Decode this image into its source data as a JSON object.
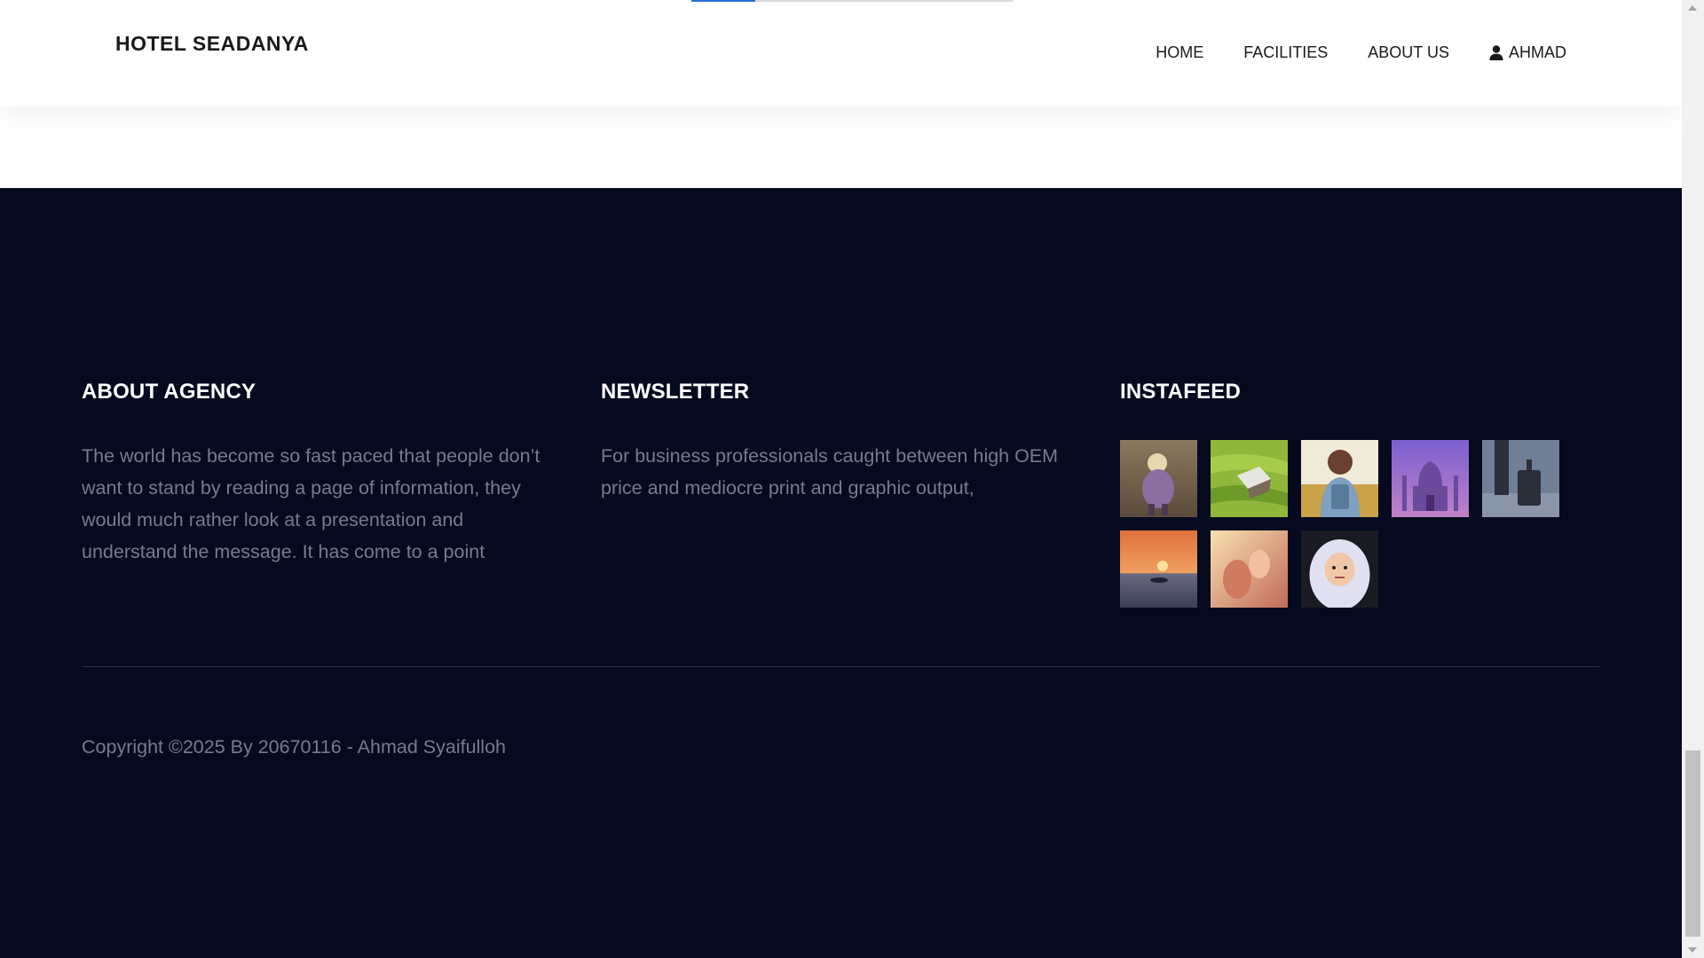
{
  "header": {
    "brand": "HOTEL SEADANYA",
    "progress_fraction": 0.2,
    "nav": [
      {
        "label": "HOME"
      },
      {
        "label": "FACILITIES"
      },
      {
        "label": "ABOUT US"
      },
      {
        "label": "AHMAD",
        "icon": "user-icon"
      }
    ]
  },
  "footer": {
    "about": {
      "title": "ABOUT AGENCY",
      "text": "The world has become so fast paced that people don’t want to stand by reading a page of information, they would much rather look at a presentation and understand the message. It has come to a point"
    },
    "newsletter": {
      "title": "NEWSLETTER",
      "text": "For business professionals caught between high OEM price and mediocre print and graphic output,"
    },
    "instafeed": {
      "title": "INSTAFEED",
      "images": [
        {
          "name": "child-walking-photo"
        },
        {
          "name": "rice-terrace-hut-photo"
        },
        {
          "name": "woman-backpack-photo"
        },
        {
          "name": "taj-mahal-photo"
        },
        {
          "name": "traveler-suitcase-photo"
        },
        {
          "name": "sunset-sea-photo"
        },
        {
          "name": "hands-sunlight-photo"
        },
        {
          "name": "child-hood-photo"
        }
      ]
    },
    "copyright": "Copyright ©2025 By 20670116 - Ahmad Syaifulloh"
  },
  "colors": {
    "footer_bg": "#050a1f",
    "accent": "#2f6fdd",
    "muted_text": "#777b8a"
  }
}
